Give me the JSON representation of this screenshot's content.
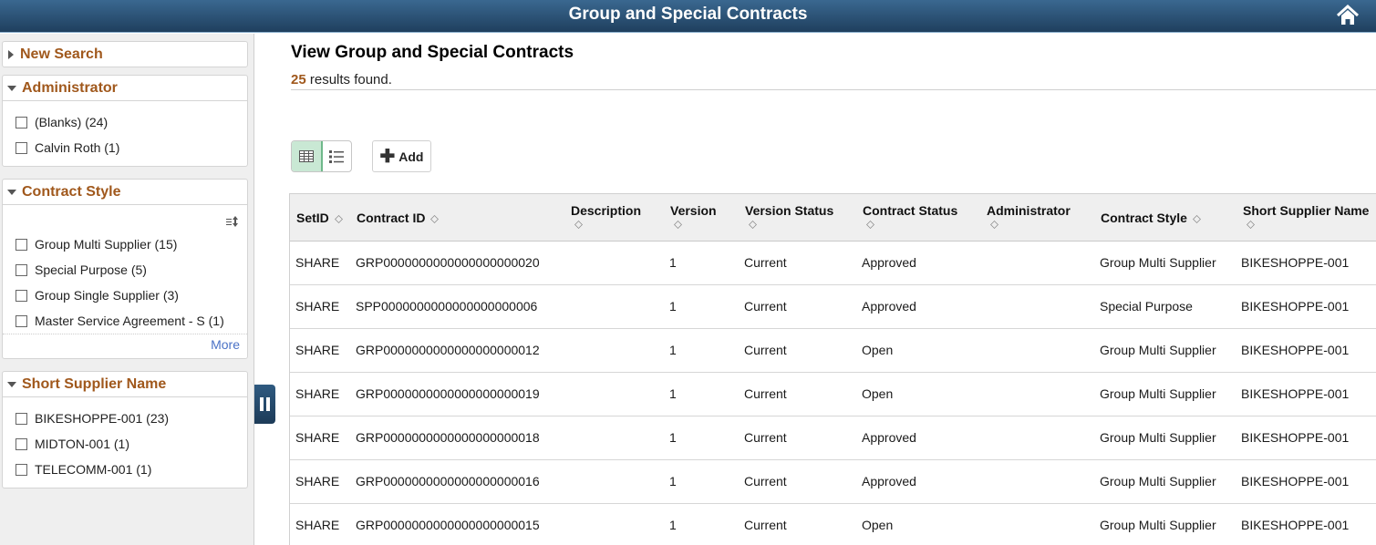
{
  "banner": {
    "title": "Group and Special Contracts",
    "home_icon": "home-icon"
  },
  "sidebar": {
    "new_search": "New Search",
    "facets": [
      {
        "title": "Administrator",
        "items": [
          "(Blanks) (24)",
          "Calvin Roth (1)"
        ]
      },
      {
        "title": "Contract Style",
        "items": [
          "Group Multi Supplier (15)",
          "Special Purpose (5)",
          "Group Single Supplier (3)",
          "Master Service Agreement - S (1)"
        ],
        "more": "More"
      },
      {
        "title": "Short Supplier Name",
        "items": [
          "BIKESHOPPE-001 (23)",
          "MIDTON-001 (1)",
          "TELECOMM-001 (1)"
        ]
      }
    ]
  },
  "main": {
    "title": "View Group and Special Contracts",
    "results_count": "25",
    "results_suffix": " results found.",
    "toolbar": {
      "add_label": "Add"
    },
    "columns": [
      "SetID",
      "Contract ID",
      "Description",
      "Version",
      "Version Status",
      "Contract Status",
      "Administrator",
      "Contract Style",
      "Short Supplier Name"
    ],
    "rows": [
      [
        "SHARE",
        "GRP0000000000000000000020",
        "",
        "1",
        "Current",
        "Approved",
        "",
        "Group Multi Supplier",
        "BIKESHOPPE-001"
      ],
      [
        "SHARE",
        "SPP0000000000000000000006",
        "",
        "1",
        "Current",
        "Approved",
        "",
        "Special Purpose",
        "BIKESHOPPE-001"
      ],
      [
        "SHARE",
        "GRP0000000000000000000012",
        "",
        "1",
        "Current",
        "Open",
        "",
        "Group Multi Supplier",
        "BIKESHOPPE-001"
      ],
      [
        "SHARE",
        "GRP0000000000000000000019",
        "",
        "1",
        "Current",
        "Open",
        "",
        "Group Multi Supplier",
        "BIKESHOPPE-001"
      ],
      [
        "SHARE",
        "GRP0000000000000000000018",
        "",
        "1",
        "Current",
        "Approved",
        "",
        "Group Multi Supplier",
        "BIKESHOPPE-001"
      ],
      [
        "SHARE",
        "GRP0000000000000000000016",
        "",
        "1",
        "Current",
        "Approved",
        "",
        "Group Multi Supplier",
        "BIKESHOPPE-001"
      ],
      [
        "SHARE",
        "GRP0000000000000000000015",
        "",
        "1",
        "Current",
        "Open",
        "",
        "Group Multi Supplier",
        "BIKESHOPPE-001"
      ]
    ]
  }
}
